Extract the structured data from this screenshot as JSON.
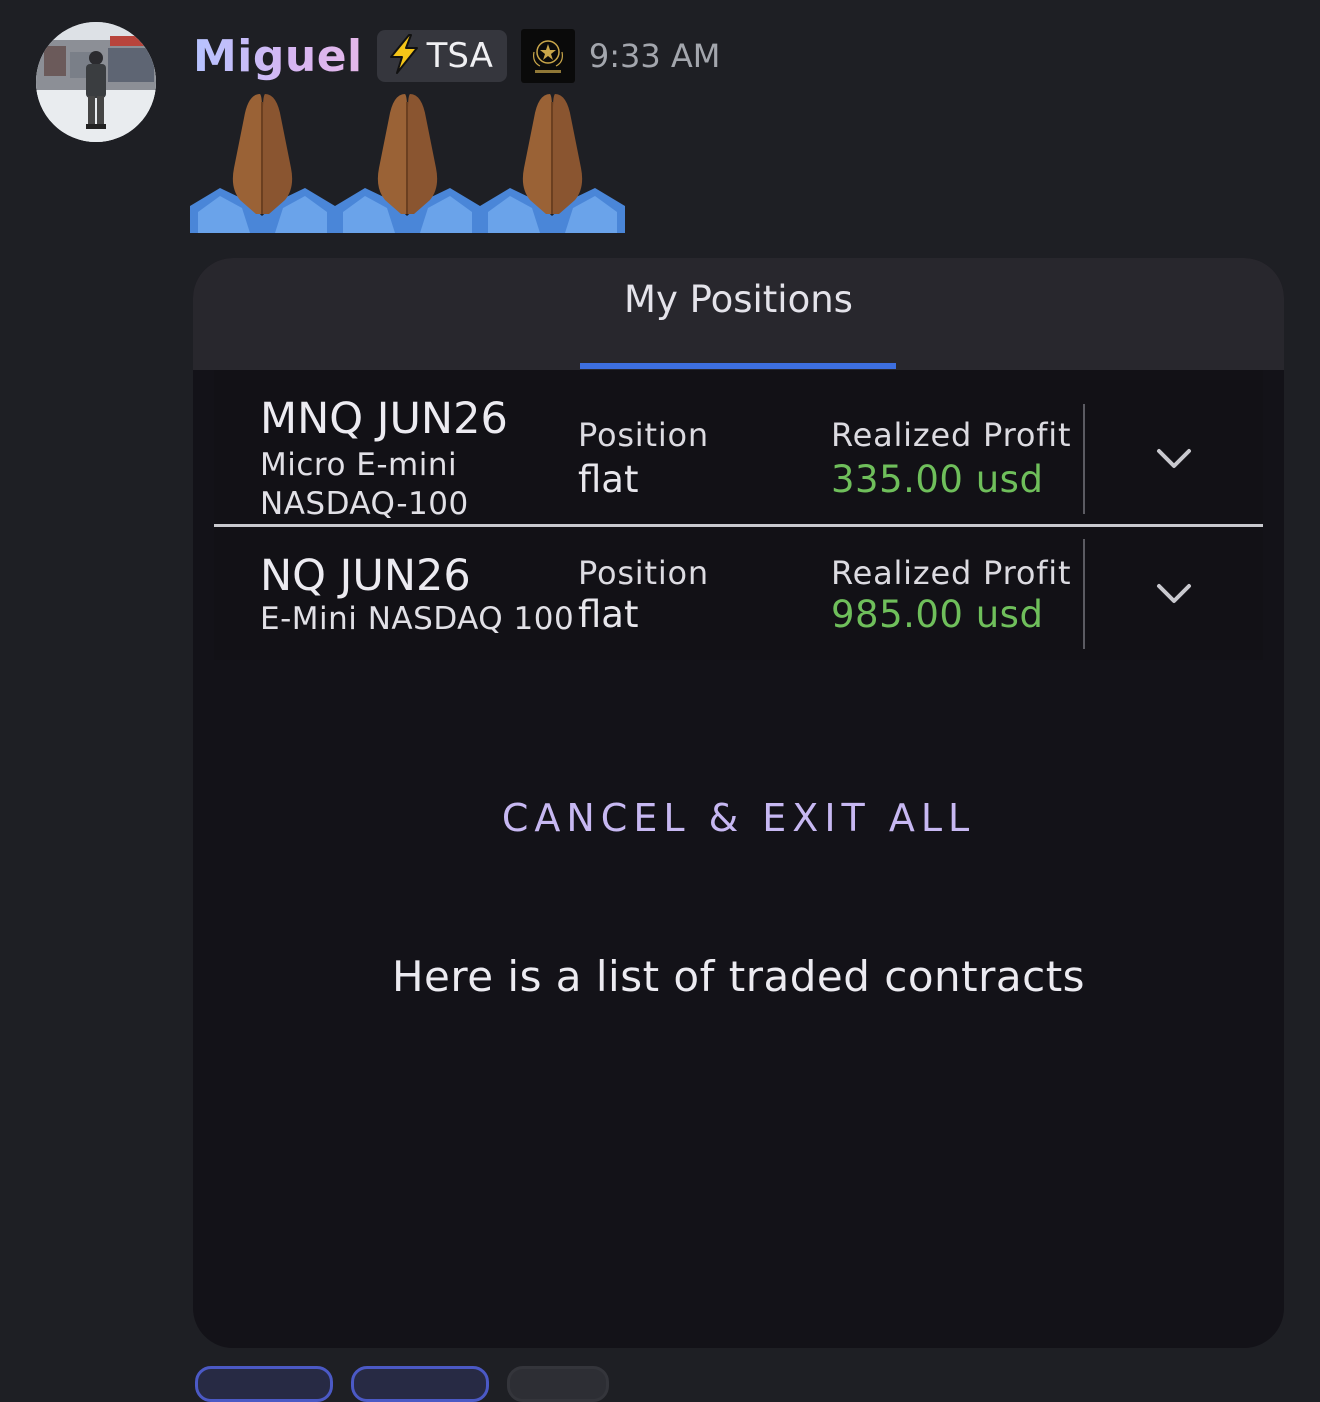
{
  "message": {
    "username": "Miguel",
    "tag": "TSA",
    "timestamp": "9:33 AM",
    "emoji": [
      "folded-hands",
      "folded-hands",
      "folded-hands"
    ]
  },
  "card": {
    "tab_title": "My Positions",
    "positions": [
      {
        "symbol": "MNQ JUN26",
        "description_line1": "Micro E-mini",
        "description_line2": "NASDAQ-100",
        "position_label": "Position",
        "position_value": "flat",
        "profit_label": "Realized Profit",
        "profit_value": "335.00 usd"
      },
      {
        "symbol": "NQ JUN26",
        "description_line1": "E-Mini NASDAQ 100",
        "position_label": "Position",
        "position_value": "flat",
        "profit_label": "Realized Profit",
        "profit_value": "985.00 usd"
      }
    ],
    "cancel_button": "CANCEL & EXIT ALL",
    "note": "Here is a list of traded contracts"
  },
  "colors": {
    "accent_tab": "#3d6fe0",
    "profit_green": "#6fbf5b",
    "cancel_text": "#c7b8f2",
    "username": "#c6b3f4"
  }
}
